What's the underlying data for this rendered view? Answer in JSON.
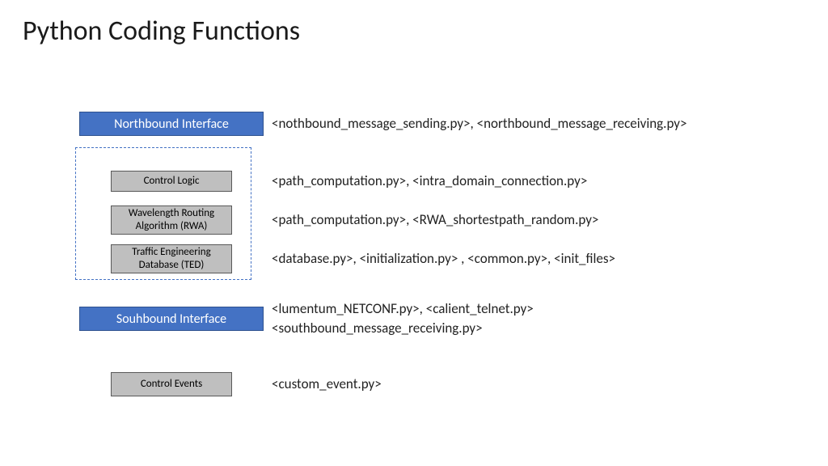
{
  "title": "Python Coding Functions",
  "rows": {
    "northbound": {
      "box_label": "Northbound Interface",
      "files": "<nothbound_message_sending.py>, <northbound_message_receiving.py>"
    },
    "control_logic": {
      "box_label": "Control Logic",
      "files": "<path_computation.py>, <intra_domain_connection.py>"
    },
    "rwa": {
      "box_label": "Wavelength Routing Algorithm (RWA)",
      "files": "<path_computation.py>, <RWA_shortestpath_random.py>"
    },
    "ted": {
      "box_label": "Traffic Engineering Database (TED)",
      "files": "<database.py>, <initialization.py> , <common.py>, <init_files>"
    },
    "southbound": {
      "box_label": "Souhbound Interface",
      "files_line1": "<lumentum_NETCONF.py>, <calient_telnet.py>",
      "files_line2": "<southbound_message_receiving.py>"
    },
    "control_events": {
      "box_label": "Control Events",
      "files": "<custom_event.py>"
    }
  }
}
